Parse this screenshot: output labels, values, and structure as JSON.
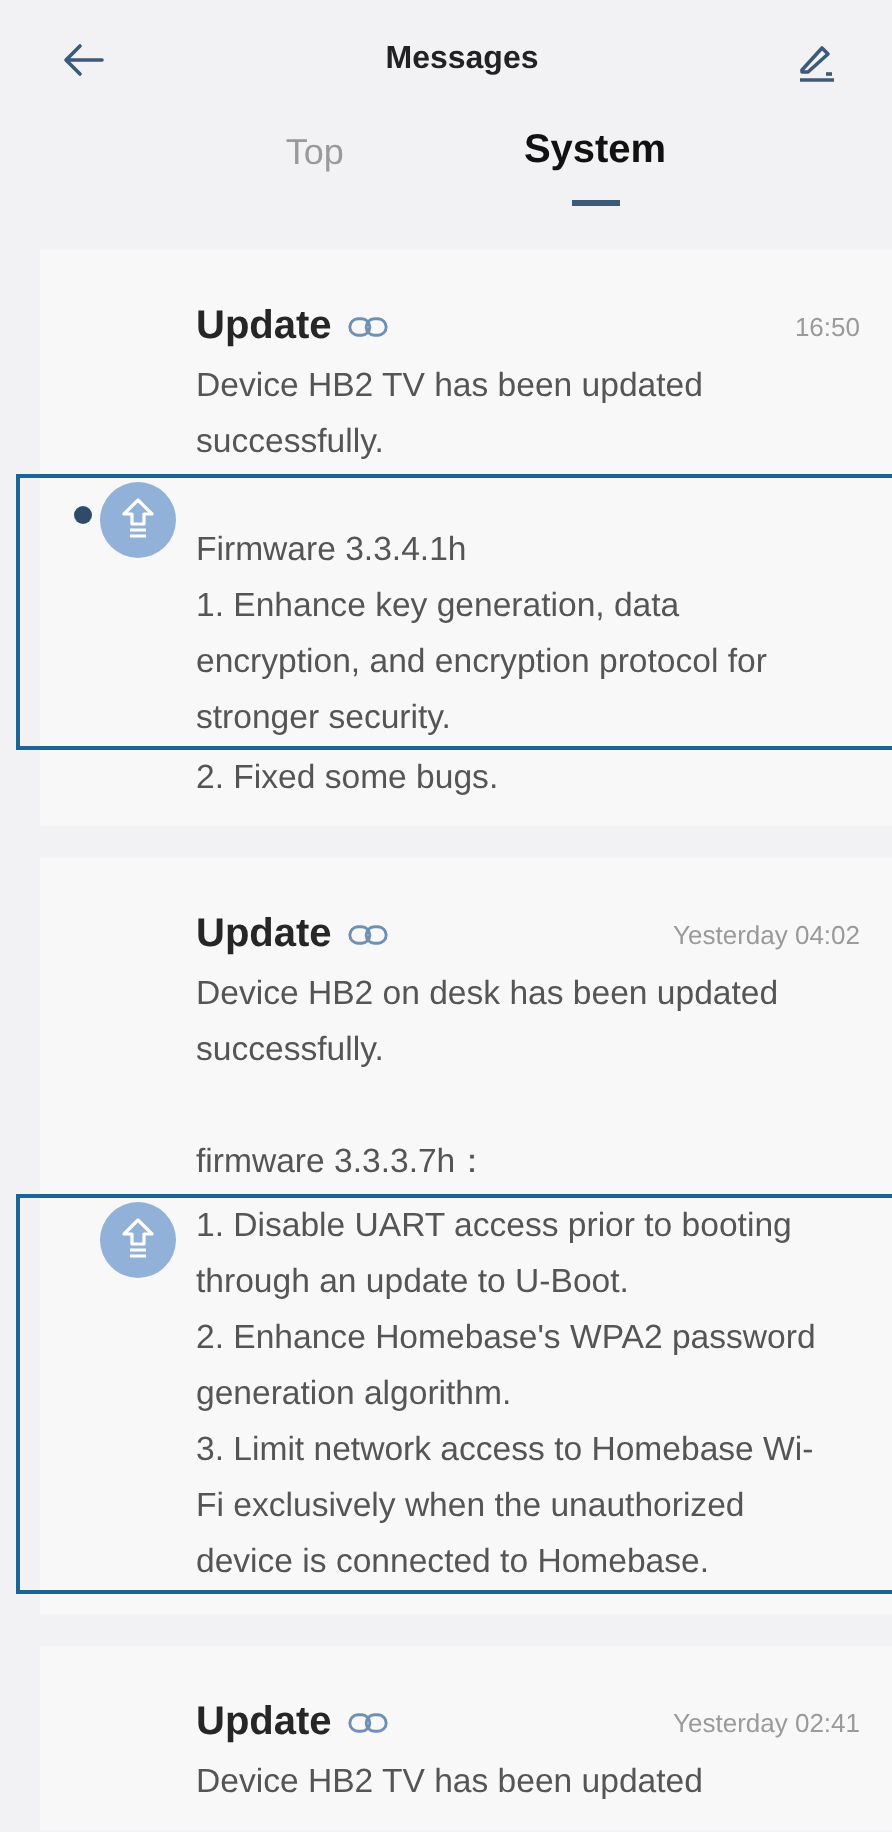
{
  "header": {
    "title": "Messages"
  },
  "tabs": [
    {
      "label": "Top",
      "selected": false
    },
    {
      "label": "System",
      "selected": true
    }
  ],
  "messages": [
    {
      "title": "Update",
      "time": "16:50",
      "before": [
        "Device HB2 TV has been updated successfully."
      ],
      "highlight": {
        "unread": true,
        "lines": [
          "Firmware 3.3.4.1h",
          "1. Enhance key generation, data encryption, and encryption protocol for stronger security."
        ]
      },
      "after": [
        "2. Fixed some bugs."
      ]
    },
    {
      "title": "Update",
      "time": "Yesterday 04:02",
      "before": [
        "Device HB2 on desk has been updated successfully.",
        "firmware 3.3.3.7h："
      ],
      "highlight": {
        "unread": false,
        "lines": [
          "1. Disable UART access prior to booting through an update to U-Boot.",
          "2. Enhance Homebase's WPA2 password generation algorithm.",
          "3. Limit network access to Homebase Wi-Fi exclusively when the unauthorized device is connected to Homebase."
        ]
      }
    },
    {
      "title": "Update",
      "time": "Yesterday 02:41",
      "before": [
        "Device HB2 TV has been updated"
      ]
    }
  ]
}
